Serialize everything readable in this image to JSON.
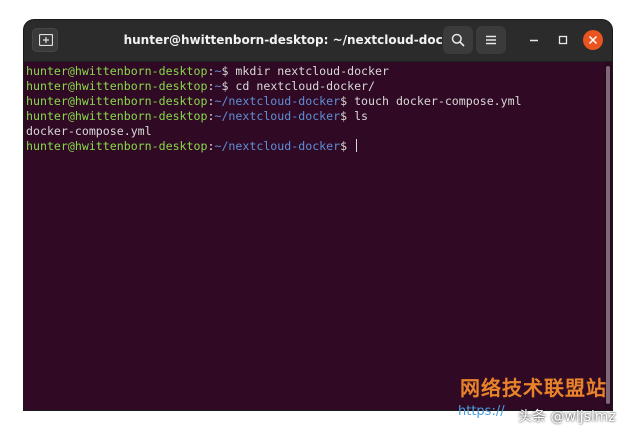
{
  "window": {
    "title": "hunter@hwittenborn-desktop: ~/nextcloud-docker"
  },
  "icons": {
    "new_tab": "new-tab-icon",
    "search": "search-icon",
    "menu": "hamburger-menu-icon",
    "minimize": "minimize-icon",
    "maximize": "maximize-icon",
    "close": "close-icon"
  },
  "colors": {
    "terminal_bg": "#300a24",
    "user_host": "#87d94a",
    "path": "#5f8fd6",
    "close_button": "#e95420"
  },
  "terminal": {
    "lines": [
      {
        "user": "hunter@hwittenborn-desktop",
        "colon": ":",
        "path": "~",
        "dollar": "$",
        "cmd": " mkdir nextcloud-docker"
      },
      {
        "user": "hunter@hwittenborn-desktop",
        "colon": ":",
        "path": "~",
        "dollar": "$",
        "cmd": " cd nextcloud-docker/"
      },
      {
        "user": "hunter@hwittenborn-desktop",
        "colon": ":",
        "path": "~/nextcloud-docker",
        "dollar": "$",
        "cmd": " touch docker-compose.yml"
      },
      {
        "user": "hunter@hwittenborn-desktop",
        "colon": ":",
        "path": "~/nextcloud-docker",
        "dollar": "$",
        "cmd": " ls"
      },
      {
        "output": "docker-compose.yml"
      },
      {
        "user": "hunter@hwittenborn-desktop",
        "colon": ":",
        "path": "~/nextcloud-docker",
        "dollar": "$",
        "cmd": " "
      }
    ]
  },
  "watermark": {
    "site_name": "网络技术联盟站",
    "url": "https://",
    "handle": "头条 @wljslmz"
  }
}
